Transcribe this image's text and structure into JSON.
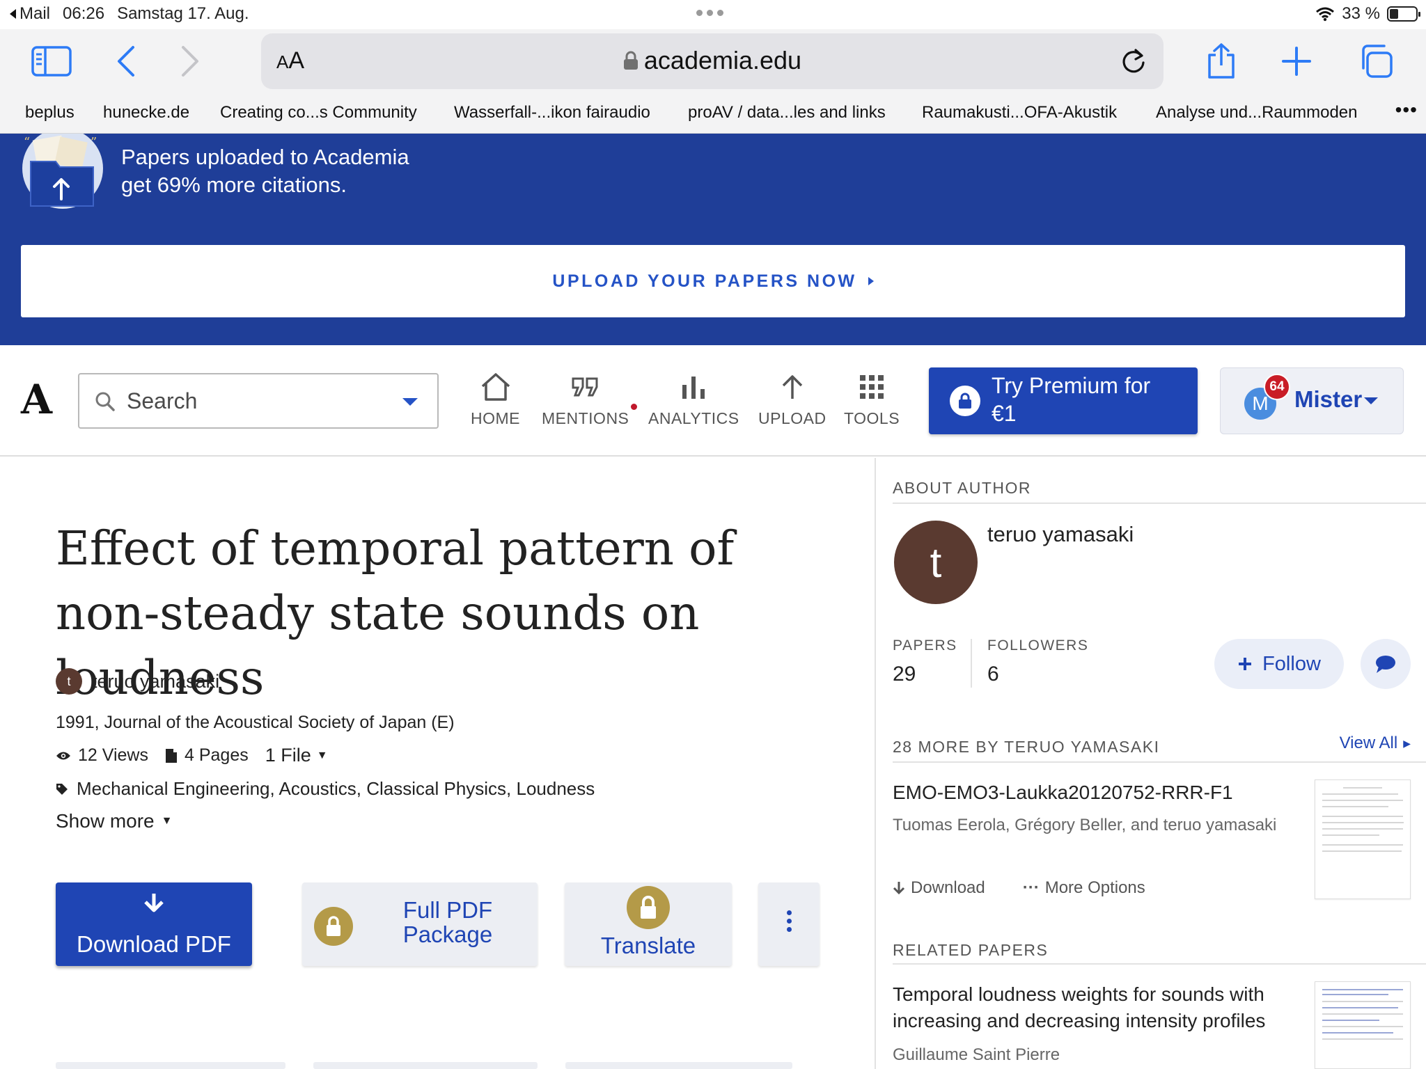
{
  "status_bar": {
    "back_app": "Mail",
    "time": "06:26",
    "date": "Samstag 17. Aug.",
    "battery": "33 %",
    "battery_level": 0.33
  },
  "browser": {
    "text_size_label": "A",
    "text_size_label_large": "A",
    "host": "academia.edu",
    "icons": [
      "sidebar-icon",
      "back-icon",
      "forward-icon",
      "lock-icon",
      "reload-icon",
      "share-icon",
      "new-tab-icon",
      "tabs-icon"
    ]
  },
  "bookmarks": [
    "beplus",
    "hunecke.de",
    "Creating co...s Community",
    "Wasserfall-...ikon fairaudio",
    "proAV / data...les and links",
    "Raumakusti...OFA-Akustik",
    "Analyse und...Raummoden"
  ],
  "bookmarks_more": "•••",
  "promo": {
    "line1": "Papers uploaded to Academia",
    "line2": "get 69% more citations.",
    "cta": "UPLOAD YOUR PAPERS NOW"
  },
  "nav": {
    "logo": "A",
    "search_placeholder": "Search",
    "items": [
      {
        "label": "HOME",
        "icon": "home-icon"
      },
      {
        "label": "MENTIONS",
        "icon": "quote-icon"
      },
      {
        "label": "ANALYTICS",
        "icon": "bar-chart-icon"
      },
      {
        "label": "UPLOAD",
        "icon": "upload-arrow-icon"
      },
      {
        "label": "TOOLS",
        "icon": "grid-icon"
      }
    ],
    "premium_line1": "Try Premium for",
    "premium_line2": "€1",
    "profile_initial": "M",
    "notification_count": "64",
    "profile_name": "Mister"
  },
  "paper": {
    "title": "Effect of temporal pattern of non-steady state sounds on loudness",
    "author_initial": "t",
    "author": "teruo yamasaki",
    "journal": "1991, Journal of the Acoustical Society of Japan (E)",
    "views": "12 Views",
    "pages": "4 Pages",
    "files": "1 File",
    "tags": "Mechanical Engineering, Acoustics, Classical Physics, Loudness",
    "show_more": "Show more",
    "actions": {
      "download": "Download PDF",
      "pdf_package": "Full PDF Package",
      "translate": "Translate"
    }
  },
  "sidebar": {
    "about_header": "ABOUT AUTHOR",
    "author_initial": "t",
    "author_name": "teruo yamasaki",
    "papers_label": "PAPERS",
    "papers_count": "29",
    "followers_label": "FOLLOWERS",
    "followers_count": "6",
    "follow_label": "Follow",
    "more_header": "28 MORE BY TERUO YAMASAKI",
    "view_all": "View All",
    "more_paper": {
      "title": "EMO-EMO3-Laukka20120752-RRR-F1",
      "authors": "Tuomas Eerola, Grégory Beller, and teruo yamasaki",
      "download": "Download",
      "more_options": "More Options"
    },
    "related_header": "RELATED PAPERS",
    "related_paper": {
      "title": "Temporal loudness weights for sounds with increasing and decreasing intensity profiles",
      "authors": "Guillaume Saint Pierre"
    }
  },
  "colors": {
    "brand_blue": "#1f45b4",
    "banner_blue": "#1f3e98",
    "link_blue": "#2553c6",
    "notification_red": "#c91d27",
    "author_avatar": "#5a3a30",
    "gold_lock": "#b49a48"
  }
}
